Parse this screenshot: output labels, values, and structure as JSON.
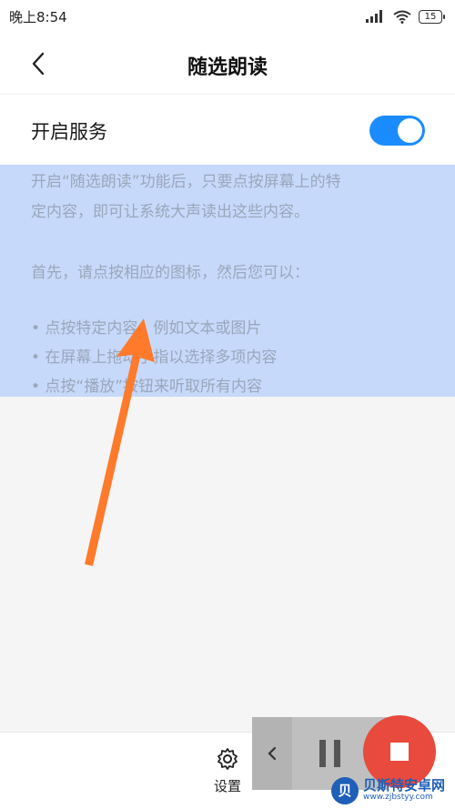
{
  "status_bar": {
    "time": "晚上8:54",
    "battery": "15"
  },
  "header": {
    "title": "随选朗读",
    "back_icon": "chevron-left-icon"
  },
  "service": {
    "label": "开启服务",
    "enabled": true,
    "accent_color": "#1a8cff"
  },
  "description": {
    "lines": [
      "开启“随选朗读”功能后，只要点按屏幕上的特",
      "定内容，即可让系统大声读出这些内容。",
      "首先，请点按相应的图标，然后您可以：",
      "• 点按特定内容，例如文本或图片",
      "• 在屏幕上拖动手指以选择多项内容",
      "• 点按“播放”按钮来听取所有内容"
    ],
    "highlight_color": "#c6d9fa"
  },
  "bottom_bar": {
    "settings_label": "设置",
    "settings_icon": "gear-icon"
  },
  "float_controls": {
    "collapse_icon": "chevron-left-icon",
    "pause_icon": "pause-icon",
    "stop_icon": "stop-icon",
    "stop_color": "#e84a3d"
  },
  "watermark": {
    "logo": "贝",
    "title": "贝斯特安卓网",
    "url": "www.zjbstyy.com"
  }
}
